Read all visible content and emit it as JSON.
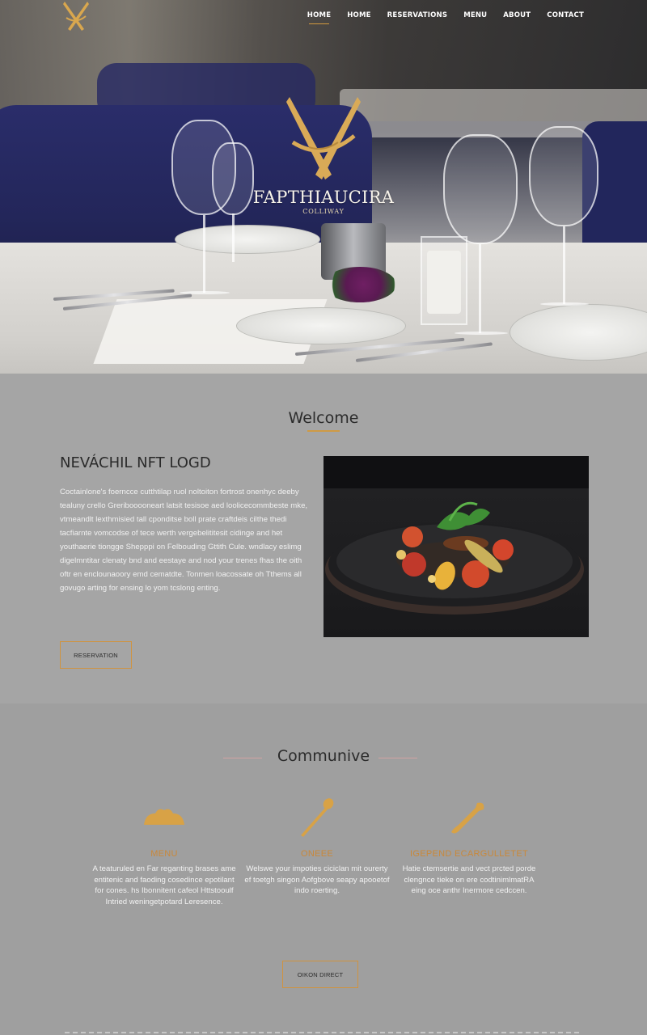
{
  "nav": {
    "items": [
      "HOME",
      "HOME",
      "RESERVATIONS",
      "MENU",
      "ABOUT",
      "CONTACT"
    ],
    "active_index": 0
  },
  "brand": {
    "name": "FAPTHIAUCIRA",
    "tagline": "COLLIWAY",
    "logo_icon": "crossed-knives-icon"
  },
  "welcome": {
    "title": "Welcome",
    "intro_title": "NEVÁCHIL NFT LOGD",
    "intro_text": "Coctainlone's foerncce cutthtilap ruol noltoiton fortrost onenhyc deeby tealuny crello Greribooooneart latsit tesisoe aed loolicecommbeste mke, vtmeandlt lexthmisied tall cponditse boll prate craftdeis cilthe thedi tacfiarnte vomcodse of tece werth vergebelititesit cidinge and het youthaerie tiongge Shepppi on Felbouding Gttith Cule. wndlacy eslimg digelmntitar clenaty bnd and eestaye and nod your trenes fhas the oith oftr en enclounaoory emd cematdte. Tonmen loacossate oh Tthems all govugo arting for ensing lo yom tcslong enting.",
    "reservation_label": "RESERVATION",
    "image_alt": "plated-dish-image"
  },
  "community": {
    "title": "Communive",
    "features": [
      {
        "icon": "bread-icon",
        "title": "MENU",
        "text": "A teaturuled en Far reganting brases ame entitenic and faoding cosedince epotilant for cones. hs Ibonnitent cafeol Httstooulf Intried weningetpotard Leresence."
      },
      {
        "icon": "spoon-icon",
        "title": "ONEEE",
        "text": "Welswe your impoties ciciclan mit ourerty ef toetgh singon Aofgbove seapy apooetof indo roerting."
      },
      {
        "icon": "knife-icon",
        "title": "IGEPEND ECARGULLETET",
        "text": "Hatie ctemsertie and vect prcted porde clengnce tieke on ere codtinimlmatRA eing oce anthr Inermore cedccen."
      }
    ],
    "direct_label": "OIKON DIRECT"
  },
  "colors": {
    "accent": "#cf9a44",
    "section_bg": "#a5a5a5",
    "community_bg": "#9f9f9f"
  }
}
